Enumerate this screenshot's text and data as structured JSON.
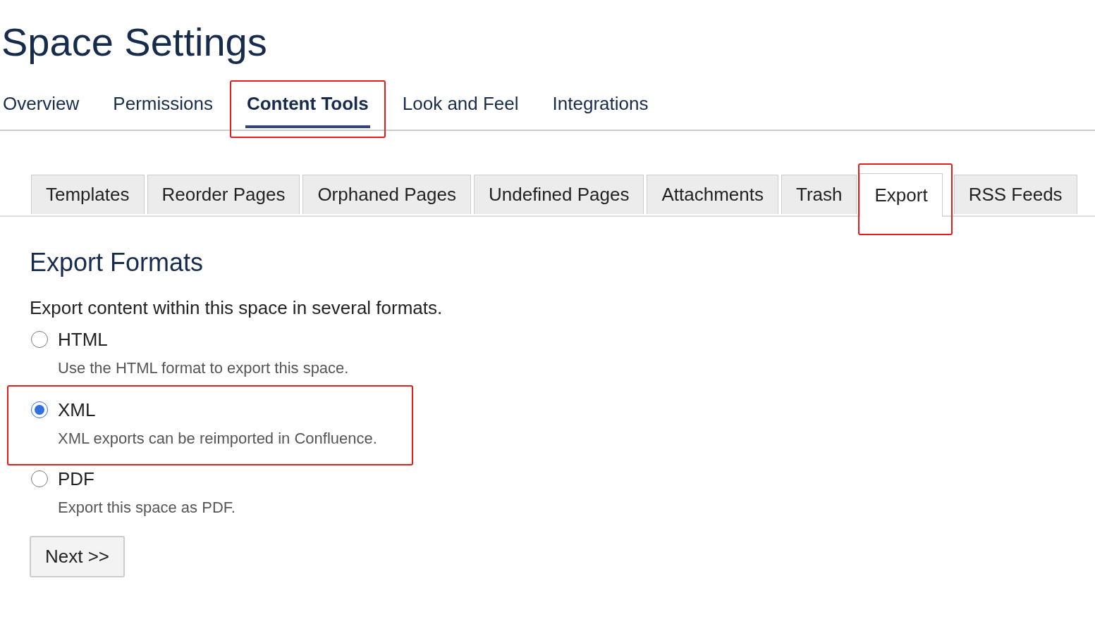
{
  "page_title": "Space Settings",
  "tabs": [
    {
      "label": "Overview",
      "selected": false,
      "highlighted": false
    },
    {
      "label": "Permissions",
      "selected": false,
      "highlighted": false
    },
    {
      "label": "Content Tools",
      "selected": true,
      "highlighted": true
    },
    {
      "label": "Look and Feel",
      "selected": false,
      "highlighted": false
    },
    {
      "label": "Integrations",
      "selected": false,
      "highlighted": false
    }
  ],
  "subtabs": [
    {
      "label": "Templates",
      "selected": false,
      "highlighted": false
    },
    {
      "label": "Reorder Pages",
      "selected": false,
      "highlighted": false
    },
    {
      "label": "Orphaned Pages",
      "selected": false,
      "highlighted": false
    },
    {
      "label": "Undefined Pages",
      "selected": false,
      "highlighted": false
    },
    {
      "label": "Attachments",
      "selected": false,
      "highlighted": false
    },
    {
      "label": "Trash",
      "selected": false,
      "highlighted": false
    },
    {
      "label": "Export",
      "selected": true,
      "highlighted": true
    },
    {
      "label": "RSS Feeds",
      "selected": false,
      "highlighted": false
    }
  ],
  "section": {
    "heading": "Export Formats",
    "intro": "Export content within this space in several formats.",
    "options": [
      {
        "label": "HTML",
        "description": "Use the HTML format to export this space.",
        "selected": false,
        "highlighted": false
      },
      {
        "label": "XML",
        "description": "XML exports can be reimported in Confluence.",
        "selected": true,
        "highlighted": true
      },
      {
        "label": "PDF",
        "description": "Export this space as PDF.",
        "selected": false,
        "highlighted": false
      }
    ],
    "button": "Next >>"
  }
}
